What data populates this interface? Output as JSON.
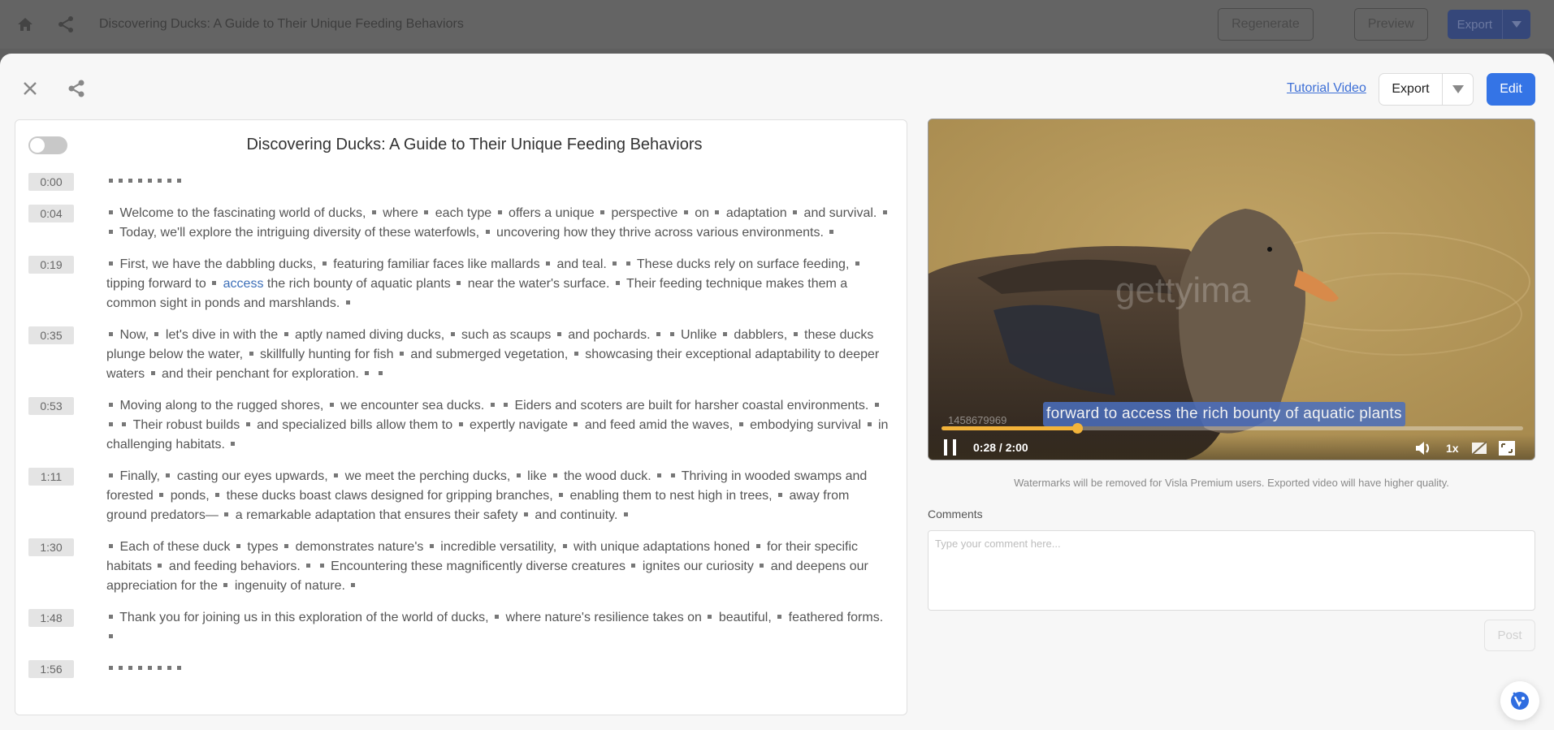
{
  "topbar": {
    "title": "Discovering Ducks: A Guide to Their Unique Feeding Behaviors",
    "regenerate_label": "Regenerate",
    "preview_label": "Preview",
    "export_label": "Export"
  },
  "modal": {
    "tutorial_link": "Tutorial Video",
    "export_label": "Export",
    "edit_label": "Edit"
  },
  "transcript": {
    "title": "Discovering Ducks: A Guide to Their Unique Feeding Behaviors",
    "toggle_on": false,
    "segments": [
      {
        "time": "0:00",
        "text": "",
        "dots": 8
      },
      {
        "time": "0:04",
        "text": "▪ Welcome to the fascinating world of ducks, ▪ where ▪ each type ▪ offers a unique ▪ perspective ▪ on ▪ adaptation ▪ and survival. ▪ ▪ Today, we'll explore the intriguing diversity of these waterfowls, ▪ uncovering how they thrive across various environments. ▪"
      },
      {
        "time": "0:19",
        "text": "▪ First, we have the dabbling ducks, ▪ featuring familiar faces like mallards ▪ and teal. ▪ ▪ These ducks rely on surface feeding, ▪ tipping forward to ▪ {access} the rich bounty of aquatic plants ▪ near the water's surface. ▪ Their feeding technique makes them a common sight in ponds and marshlands. ▪",
        "highlight": "access"
      },
      {
        "time": "0:35",
        "text": "▪ Now, ▪ let's dive in with the ▪ aptly named diving ducks, ▪ such as scaups ▪ and pochards. ▪ ▪ Unlike ▪ dabblers, ▪ these ducks plunge below the water, ▪ skillfully hunting for fish ▪ and submerged vegetation, ▪ showcasing their exceptional adaptability to deeper waters ▪ and their penchant for exploration. ▪ ▪"
      },
      {
        "time": "0:53",
        "text": "▪ Moving along to the rugged shores, ▪ we encounter sea ducks. ▪ ▪ Eiders and scoters are built for harsher coastal environments. ▪ ▪ ▪ Their robust builds ▪ and specialized bills allow them to ▪ expertly navigate ▪ and feed amid the waves, ▪ embodying survival ▪ in challenging habitats. ▪"
      },
      {
        "time": "1:11",
        "text": "▪ Finally, ▪ casting our eyes upwards, ▪ we meet the perching ducks, ▪ like ▪ the wood duck. ▪ ▪ Thriving in wooded swamps and forested ▪ ponds, ▪ these ducks boast claws designed for gripping branches, ▪ enabling them to nest high in trees, ▪ away from ground predators— ▪ a remarkable adaptation that ensures their safety ▪ and continuity. ▪"
      },
      {
        "time": "1:30",
        "text": "▪ Each of these duck ▪ types ▪ demonstrates nature's ▪ incredible versatility, ▪ with unique adaptations honed ▪ for their specific habitats ▪ and feeding behaviors. ▪ ▪ Encountering these magnificently diverse creatures ▪ ignites our curiosity ▪ and deepens our appreciation for the ▪ ingenuity of nature. ▪"
      },
      {
        "time": "1:48",
        "text": "▪ Thank you for joining us in this exploration of the world of ducks, ▪ where nature's resilience takes on ▪ beautiful, ▪ feathered forms. ▪"
      },
      {
        "time": "1:56",
        "text": "",
        "dots": 8
      }
    ]
  },
  "video": {
    "caption": "forward to access the rich bounty of aquatic plants",
    "watermark_id": "1458679969",
    "watermark_text": "gettyima",
    "current_time": "0:28",
    "duration": "2:00",
    "time_display": "0:28 / 2:00",
    "progress_fraction": 0.233,
    "speed": "1x",
    "playing": true
  },
  "notes": {
    "watermark_note": "Watermarks will be removed for Visla Premium users. Exported video will have higher quality."
  },
  "comments": {
    "label": "Comments",
    "placeholder": "Type your comment here...",
    "value": "",
    "post_label": "Post"
  },
  "colors": {
    "accent": "#3474e6",
    "link": "#3d6fd6",
    "progress": "#f2b33a",
    "caption_bg": "#4a6ebe"
  }
}
